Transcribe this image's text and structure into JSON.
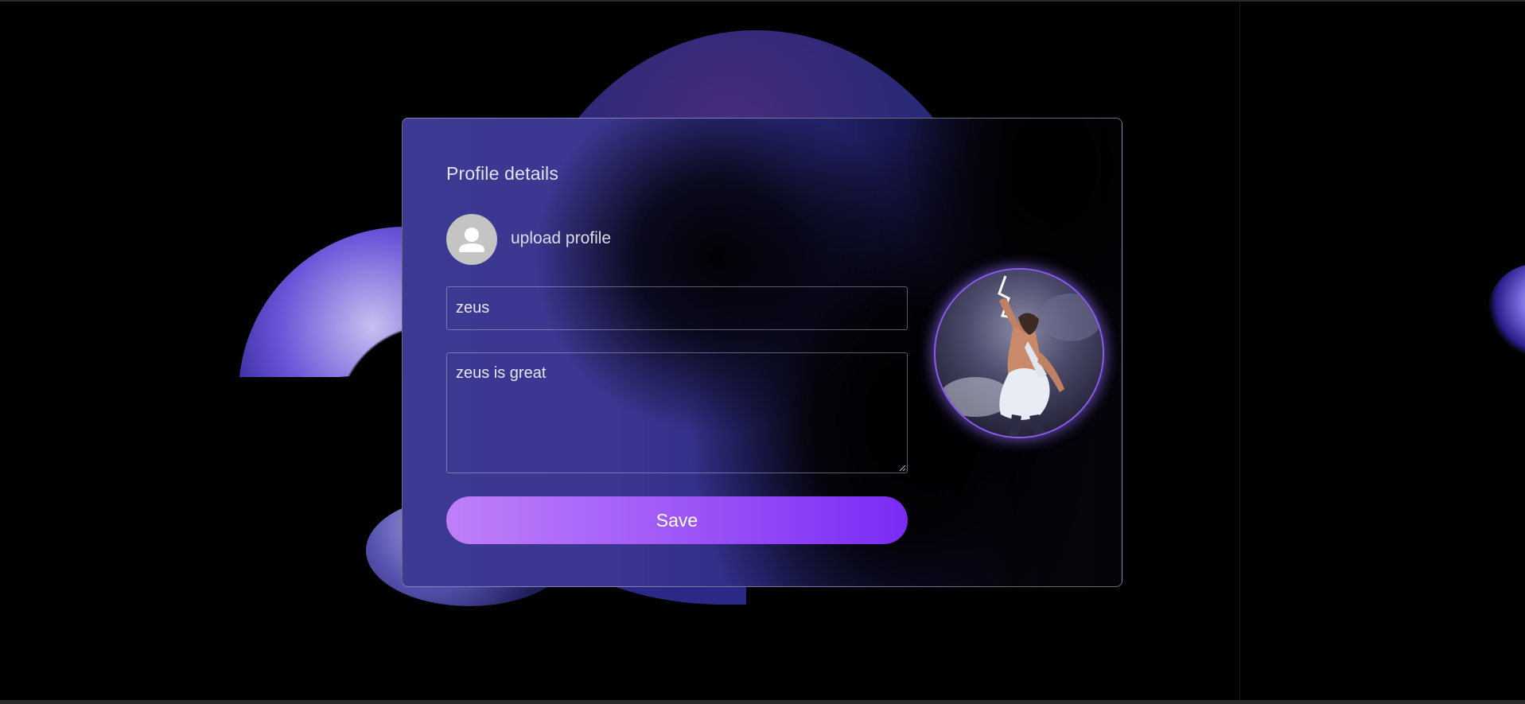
{
  "card": {
    "title": "Profile details",
    "upload_label": "upload profile",
    "name_value": "zeus",
    "bio_value": "zeus is great",
    "save_label": "Save"
  },
  "colors": {
    "accent_start": "#bf7ff9",
    "accent_end": "#7a2bf5",
    "profile_ring": "#8a5cf0",
    "background": "#010101"
  },
  "icons": {
    "avatar_placeholder": "user-silhouette-icon",
    "resize": "resize-grip-icon"
  }
}
